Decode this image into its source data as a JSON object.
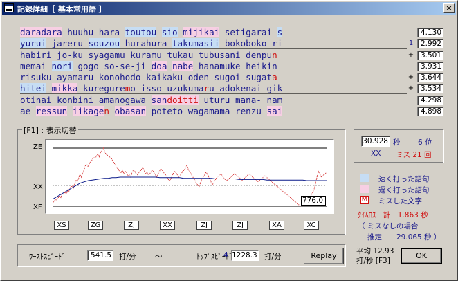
{
  "window": {
    "title": "記録詳細［ 基本常用語 ］",
    "close": "×"
  },
  "phrase_rows": [
    {
      "words": [
        {
          "t": "daradara",
          "s": "slow"
        },
        {
          "t": " "
        },
        {
          "t": "huuhu"
        },
        {
          "t": " "
        },
        {
          "t": "hara"
        },
        {
          "t": " "
        },
        {
          "t": "toutou",
          "s": "fast"
        },
        {
          "t": " "
        },
        {
          "t": "sio",
          "s": "fast"
        },
        {
          "t": " "
        },
        {
          "t": "mijikai",
          "s": "slow"
        },
        {
          "t": " "
        },
        {
          "t": "setigarai"
        },
        {
          "t": " "
        },
        {
          "t": "s",
          "s": "fast"
        }
      ],
      "marker": "",
      "time": "4.130"
    },
    {
      "words": [
        {
          "t": "yurui",
          "s": "fast"
        },
        {
          "t": " "
        },
        {
          "t": "jareru"
        },
        {
          "t": " "
        },
        {
          "t": "souzou",
          "s": "fast"
        },
        {
          "t": " "
        },
        {
          "t": "hurahura"
        },
        {
          "t": " "
        },
        {
          "t": "takumasii",
          "s": "fast"
        },
        {
          "t": " "
        },
        {
          "t": "bokoboko"
        },
        {
          "t": " "
        },
        {
          "t": "ri"
        }
      ],
      "marker": "1",
      "time": "2.992"
    },
    {
      "words": [
        {
          "t": "habiri"
        },
        {
          "t": " "
        },
        {
          "t": "jo-ku"
        },
        {
          "t": " "
        },
        {
          "t": "syagamu"
        },
        {
          "t": " "
        },
        {
          "t": "kuramu"
        },
        {
          "t": " "
        },
        {
          "t": "tukau"
        },
        {
          "t": " "
        },
        {
          "t": "tubusani"
        },
        {
          "t": " "
        },
        {
          "t": "denpu"
        },
        {
          "t": "n",
          "m": true
        }
      ],
      "marker": "+",
      "time": "3.501"
    },
    {
      "words": [
        {
          "t": "memai"
        },
        {
          "t": " "
        },
        {
          "t": "nori",
          "s": "fast"
        },
        {
          "t": " "
        },
        {
          "t": "gogo"
        },
        {
          "t": " "
        },
        {
          "t": "so-se-ji"
        },
        {
          "t": " "
        },
        {
          "t": "doa",
          "s": "slow"
        },
        {
          "t": " "
        },
        {
          "t": "nabe",
          "s": "slow"
        },
        {
          "t": " "
        },
        {
          "t": "hanamuke"
        },
        {
          "t": " "
        },
        {
          "t": "heikin"
        }
      ],
      "marker": "",
      "time": "3.931"
    },
    {
      "words": [
        {
          "t": "risuku"
        },
        {
          "t": " "
        },
        {
          "t": "ayamaru"
        },
        {
          "t": " "
        },
        {
          "t": "konohodo"
        },
        {
          "t": " "
        },
        {
          "t": "kaikaku"
        },
        {
          "t": " "
        },
        {
          "t": "oden"
        },
        {
          "t": " "
        },
        {
          "t": "sugoi"
        },
        {
          "t": " "
        },
        {
          "t": "sugat"
        },
        {
          "t": "a",
          "m": true
        }
      ],
      "marker": "+",
      "time": "3.644"
    },
    {
      "words": [
        {
          "t": "hitei",
          "s": "fast"
        },
        {
          "t": " "
        },
        {
          "t": "mikka",
          "s": "slow"
        },
        {
          "t": " "
        },
        {
          "t": "kuregure"
        },
        {
          "t": "m",
          "m": true
        },
        {
          "t": "o"
        },
        {
          "t": " "
        },
        {
          "t": "isso"
        },
        {
          "t": " "
        },
        {
          "t": "uzukuma"
        },
        {
          "t": "r",
          "m": true
        },
        {
          "t": "u"
        },
        {
          "t": " "
        },
        {
          "t": "adokenai"
        },
        {
          "t": " "
        },
        {
          "t": "gik"
        }
      ],
      "marker": "+",
      "time": "3.534"
    },
    {
      "words": [
        {
          "t": "otinai"
        },
        {
          "t": " "
        },
        {
          "t": "konbini"
        },
        {
          "t": " "
        },
        {
          "t": "amanogawa"
        },
        {
          "t": " "
        },
        {
          "t": "san",
          "s": "slow"
        },
        {
          "t": "doitti",
          "s": "slowmiss"
        },
        {
          "t": " "
        },
        {
          "t": "uturu"
        },
        {
          "t": " "
        },
        {
          "t": "mana-"
        },
        {
          "t": " "
        },
        {
          "t": "nam"
        }
      ],
      "marker": "",
      "time": "4.298"
    },
    {
      "words": [
        {
          "t": "ae"
        },
        {
          "t": " "
        },
        {
          "t": "ressun",
          "s": "slow"
        },
        {
          "t": " "
        },
        {
          "t": "iikage",
          "s": "slow"
        },
        {
          "t": "n",
          "m": true
        },
        {
          "t": " "
        },
        {
          "t": "obasan",
          "s": "slow"
        },
        {
          "t": " "
        },
        {
          "t": "poteto"
        },
        {
          "t": " "
        },
        {
          "t": "wagamama"
        },
        {
          "t": " "
        },
        {
          "t": "renzu"
        },
        {
          "t": " "
        },
        {
          "t": "sai",
          "s": "slow"
        }
      ],
      "marker": "",
      "time": "4.898"
    }
  ],
  "graph_group": {
    "label": "[F1] : 表示切替"
  },
  "graph": {
    "labels": {
      "top": "ZE",
      "mid": "XX",
      "bottom": "XF"
    },
    "score": "776.0",
    "colors": {
      "speed": "#d02020",
      "average": "#0a1a8a",
      "dots": "#0a1a8a"
    },
    "speed_series": [
      5,
      8,
      12,
      10,
      14,
      18,
      15,
      22,
      20,
      24,
      20,
      28,
      26,
      32,
      35,
      30,
      38,
      45,
      42,
      48,
      55,
      50,
      58,
      62,
      70,
      72,
      68,
      74,
      78,
      80,
      84,
      82,
      86,
      90,
      85,
      92,
      96,
      100,
      94,
      90,
      88,
      86,
      84,
      82,
      78,
      74,
      70,
      66,
      64,
      60,
      58,
      62,
      56,
      60,
      58,
      52,
      54,
      50,
      58,
      62,
      60,
      56,
      54,
      58,
      60,
      64,
      66,
      60,
      56,
      58,
      54,
      56,
      60,
      62,
      58,
      54,
      50,
      56,
      60,
      64,
      62,
      58,
      56,
      52,
      48,
      44,
      46,
      50,
      56,
      60,
      58,
      54,
      50,
      52,
      56,
      60,
      62,
      66,
      70,
      64,
      60,
      56,
      52,
      48,
      44,
      40,
      36,
      34,
      40,
      46,
      50,
      54,
      58,
      56,
      50,
      46,
      40,
      38,
      42,
      46,
      50,
      52,
      54,
      56,
      52,
      48,
      46,
      44,
      46,
      48,
      50,
      52,
      54,
      56,
      54,
      52,
      50,
      48,
      44,
      46,
      48,
      50,
      52,
      56,
      54,
      52,
      50,
      48,
      46,
      44,
      42,
      44,
      46,
      48,
      50,
      52,
      50,
      48,
      46,
      44,
      42,
      40,
      38,
      36,
      34,
      32,
      30,
      28,
      26,
      24,
      22,
      20,
      18,
      16,
      14,
      12,
      10,
      8,
      6,
      4,
      2,
      0,
      2,
      4,
      6,
      8,
      10,
      12,
      16,
      20,
      24,
      30,
      40,
      50,
      60,
      56,
      50,
      52,
      54,
      56,
      58
    ],
    "avg_series": [
      12,
      16,
      20,
      24,
      28,
      32,
      36,
      40,
      42,
      44,
      45,
      46,
      47,
      48,
      48,
      49,
      49,
      50,
      50,
      50,
      50,
      50,
      50,
      50,
      50,
      50,
      50,
      49,
      49,
      49,
      49,
      49,
      49,
      48,
      48,
      48,
      48,
      48,
      48,
      48,
      48,
      47,
      47,
      47,
      47,
      47,
      47,
      46,
      46,
      46,
      46,
      46,
      46,
      46,
      45,
      45,
      45,
      45,
      45,
      45,
      45,
      45,
      45,
      45,
      44,
      44,
      44,
      44,
      44,
      44
    ],
    "level_labels": [
      "XS",
      "ZG",
      "ZJ",
      "XX",
      "ZJ",
      "ZJ",
      "XA",
      "XC"
    ]
  },
  "speed_bar": {
    "worst_label": "ﾜｰｽﾄｽﾋﾟｰﾄﾞ",
    "worst_value": "541.5",
    "unit": "打/分",
    "tilde": "〜",
    "top_label": "ﾄｯﾌﾟｽﾋﾟｰﾄﾞ",
    "top_index": "4",
    "top_value": "1228.3",
    "unit2": "打/分"
  },
  "result": {
    "total_time": "30.928",
    "seconds_unit": "秒",
    "rank": "6 位",
    "level": "XX",
    "miss_text": "ミス 21 回"
  },
  "legend": {
    "fast_label": "速く打った語句",
    "slow_label": "遅く打った語句",
    "miss_mark": "M",
    "miss_label": "ミスした文字",
    "fast_color": "#c6ddf4",
    "slow_color": "#f7cfe3"
  },
  "time_loss": {
    "line1": "ﾀｲﾑﾛｽ　計　1.863 秒",
    "line2": "（ ミスなしの場合",
    "line3": "推定　　29.065 秒 ）"
  },
  "average": {
    "line1": "平均 12.93",
    "line2": "打/秒 [F3]"
  },
  "buttons": {
    "replay": "Replay",
    "ok": "OK"
  }
}
